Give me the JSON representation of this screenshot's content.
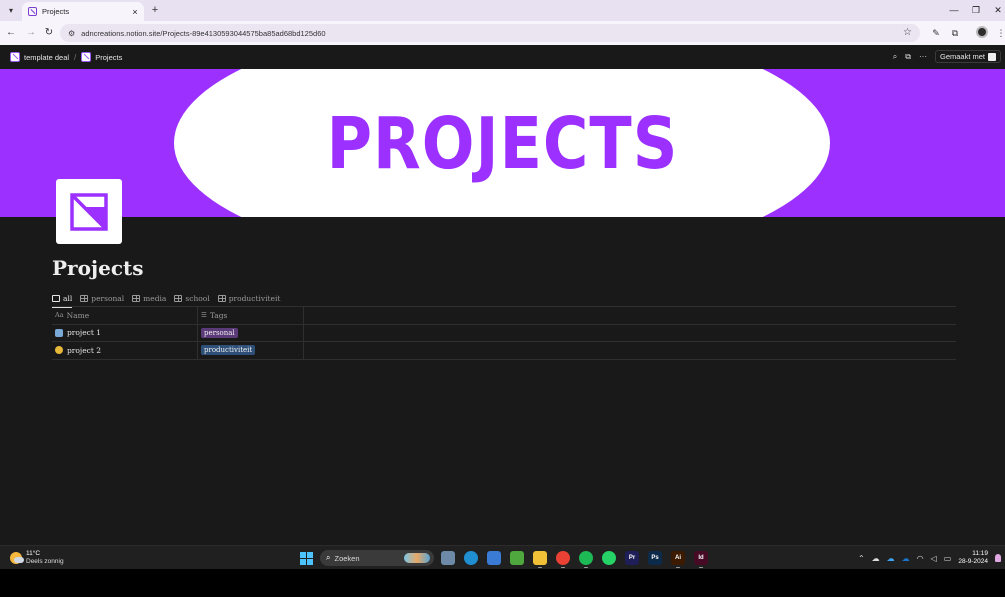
{
  "browser": {
    "tab_title": "Projects",
    "url": "adncreations.notion.site/Projects-89e4130593044575ba85ad68bd125d60",
    "new_tab_glyph": "+",
    "tab_close_glyph": "×",
    "tab_menu_glyph": "▾"
  },
  "notion_topbar": {
    "breadcrumb": [
      {
        "label": "template deal"
      },
      {
        "label": "Projects"
      }
    ],
    "separator": "/",
    "made_with_label": "Gemaakt met",
    "more_glyph": "···"
  },
  "page": {
    "cover_text": "PROJECTS",
    "title": "Projects",
    "views": [
      {
        "label": "all"
      },
      {
        "label": "personal"
      },
      {
        "label": "media"
      },
      {
        "label": "school"
      },
      {
        "label": "productiviteit"
      }
    ],
    "table": {
      "columns": [
        {
          "icon": "Aa",
          "label": "Name"
        },
        {
          "icon": "☰",
          "label": "Tags"
        }
      ],
      "rows": [
        {
          "name": "project 1",
          "emoji_color": "#7aa9d8",
          "tag": "personal",
          "tag_color": "#5a3a78"
        },
        {
          "name": "project 2",
          "emoji_color": "#e8b83a",
          "tag": "productiviteit",
          "tag_color": "#2e4f78"
        }
      ]
    }
  },
  "taskbar": {
    "weather_temp": "11°C",
    "weather_condition": "Deels zonnig",
    "search_placeholder": "Zoeken",
    "time": "11:19",
    "date": "28-9-2024",
    "apps": [
      {
        "name": "explorer-files",
        "label": "",
        "color": "#6d8ba8"
      },
      {
        "name": "edge",
        "label": "",
        "color": "#1f8fd1"
      },
      {
        "name": "store",
        "label": "",
        "color": "#3a7bd5"
      },
      {
        "name": "minecraft",
        "label": "",
        "color": "#4fa83d"
      },
      {
        "name": "file-explorer",
        "label": "",
        "color": "#f2c037"
      },
      {
        "name": "chrome",
        "label": "",
        "color": "#e94235"
      },
      {
        "name": "spotify",
        "label": "",
        "color": "#1db954"
      },
      {
        "name": "whatsapp",
        "label": "",
        "color": "#25d366"
      },
      {
        "name": "premiere",
        "label": "Pr",
        "color": "#1e1e58"
      },
      {
        "name": "photoshop",
        "label": "Ps",
        "color": "#0c2b4a"
      },
      {
        "name": "illustrator",
        "label": "Ai",
        "color": "#3b1a00"
      },
      {
        "name": "indesign",
        "label": "Id",
        "color": "#470a25"
      }
    ]
  },
  "colors": {
    "cover_purple": "#9b30ff",
    "notion_bg": "#191919",
    "taskbar_bg": "#202020"
  }
}
